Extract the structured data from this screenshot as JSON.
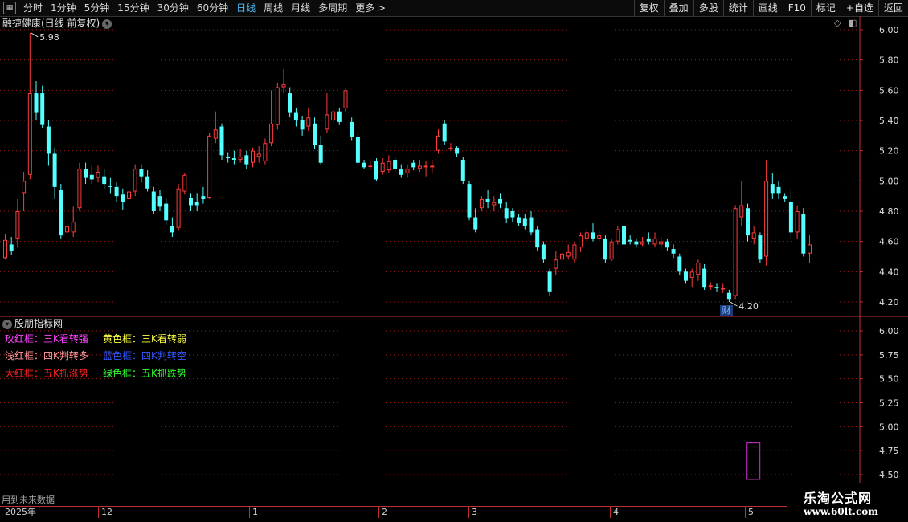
{
  "colors": {
    "up": "#ff3b3b",
    "down": "#54ffff",
    "grid": "#9a1c1c",
    "axis_text": "#e0e0e0",
    "highlight": "#cc33cc"
  },
  "toolbar": {
    "left_items": [
      {
        "label": "分时"
      },
      {
        "label": "1分钟"
      },
      {
        "label": "5分钟"
      },
      {
        "label": "15分钟"
      },
      {
        "label": "30分钟"
      },
      {
        "label": "60分钟"
      },
      {
        "label": "日线",
        "active": true
      },
      {
        "label": "周线"
      },
      {
        "label": "月线"
      },
      {
        "label": "多周期"
      },
      {
        "label": "更多 >"
      }
    ],
    "right_buttons": [
      "复权",
      "叠加",
      "多股",
      "统计",
      "画线",
      "F10",
      "标记",
      "+自选",
      "返回"
    ]
  },
  "main_panel": {
    "title": "融捷健康(日线 前复权)",
    "price_labels": [
      "6.00",
      "5.80",
      "5.60",
      "5.40",
      "5.20",
      "5.00",
      "4.80",
      "4.60",
      "4.40",
      "4.20"
    ],
    "high_annotation": "5.98",
    "low_annotation": "4.20",
    "badge": "财"
  },
  "sub_panel": {
    "title": "股朋指标网",
    "axis_labels": [
      "6.00",
      "5.75",
      "5.50",
      "5.25",
      "5.00",
      "4.75",
      "4.50"
    ],
    "legend": [
      {
        "text": "玫红框：三K看转强",
        "color": "#ff44ff"
      },
      {
        "text": "黄色框：三K看转弱",
        "color": "#ffff44"
      },
      {
        "text": "浅红框：四K判转多",
        "color": "#ff9999"
      },
      {
        "text": "蓝色框：四K判转空",
        "color": "#3355ff"
      },
      {
        "text": "大红框：五K抓涨势",
        "color": "#ff2222"
      },
      {
        "text": "绿色框：五K抓跌势",
        "color": "#33ff33"
      }
    ],
    "footnote": "用到未来数据"
  },
  "date_axis": [
    "2025年",
    "12",
    "1",
    "2",
    "3",
    "4",
    "5"
  ],
  "watermark": {
    "line1": "乐淘公式网",
    "line2": "www.60lt.com"
  },
  "chart_data": {
    "type": "candlestick",
    "title": "融捷健康(日线 前复权)",
    "ylim": [
      4.14,
      6.06
    ],
    "y_ticks": [
      6.0,
      5.8,
      5.6,
      5.4,
      5.2,
      5.0,
      4.8,
      4.6,
      4.4,
      4.2
    ],
    "annotations": [
      {
        "label": "5.98",
        "value": 5.98
      },
      {
        "label": "4.20",
        "value": 4.2
      }
    ],
    "candles": [
      {
        "o": 4.49,
        "c": 4.61,
        "h": 4.65,
        "l": 4.48
      },
      {
        "o": 4.58,
        "c": 4.54,
        "h": 4.63,
        "l": 4.51
      },
      {
        "o": 4.62,
        "c": 4.8,
        "h": 4.88,
        "l": 4.56
      },
      {
        "o": 4.92,
        "c": 5.0,
        "h": 5.06,
        "l": 4.8
      },
      {
        "o": 5.04,
        "c": 5.58,
        "h": 5.98,
        "l": 5.01
      },
      {
        "o": 5.58,
        "c": 5.45,
        "h": 5.66,
        "l": 5.4
      },
      {
        "o": 5.58,
        "c": 5.37,
        "h": 5.63,
        "l": 5.35
      },
      {
        "o": 5.36,
        "c": 5.18,
        "h": 5.4,
        "l": 5.1
      },
      {
        "o": 5.18,
        "c": 4.96,
        "h": 5.22,
        "l": 4.88
      },
      {
        "o": 4.94,
        "c": 4.64,
        "h": 4.98,
        "l": 4.62
      },
      {
        "o": 4.66,
        "c": 4.7,
        "h": 4.74,
        "l": 4.6
      },
      {
        "o": 4.66,
        "c": 4.73,
        "h": 4.83,
        "l": 4.63
      },
      {
        "o": 4.82,
        "c": 5.08,
        "h": 5.12,
        "l": 4.8
      },
      {
        "o": 5.08,
        "c": 5.02,
        "h": 5.12,
        "l": 4.98
      },
      {
        "o": 5.04,
        "c": 5.01,
        "h": 5.1,
        "l": 4.98
      },
      {
        "o": 5.02,
        "c": 5.06,
        "h": 5.1,
        "l": 4.99
      },
      {
        "o": 5.03,
        "c": 4.98,
        "h": 5.08,
        "l": 4.95
      },
      {
        "o": 4.97,
        "c": 4.96,
        "h": 5.02,
        "l": 4.92
      },
      {
        "o": 4.96,
        "c": 4.9,
        "h": 4.99,
        "l": 4.86
      },
      {
        "o": 4.91,
        "c": 4.86,
        "h": 4.95,
        "l": 4.81
      },
      {
        "o": 4.88,
        "c": 4.93,
        "h": 4.96,
        "l": 4.84
      },
      {
        "o": 4.93,
        "c": 5.08,
        "h": 5.11,
        "l": 4.9
      },
      {
        "o": 5.08,
        "c": 5.03,
        "h": 5.11,
        "l": 4.99
      },
      {
        "o": 5.03,
        "c": 4.95,
        "h": 5.07,
        "l": 4.93
      },
      {
        "o": 4.93,
        "c": 4.8,
        "h": 4.96,
        "l": 4.78
      },
      {
        "o": 4.9,
        "c": 4.83,
        "h": 4.94,
        "l": 4.8
      },
      {
        "o": 4.85,
        "c": 4.74,
        "h": 4.89,
        "l": 4.71
      },
      {
        "o": 4.7,
        "c": 4.66,
        "h": 4.76,
        "l": 4.63
      },
      {
        "o": 4.69,
        "c": 4.95,
        "h": 4.98,
        "l": 4.67
      },
      {
        "o": 4.93,
        "c": 5.04,
        "h": 5.05,
        "l": 4.91
      },
      {
        "o": 4.89,
        "c": 4.84,
        "h": 4.92,
        "l": 4.8
      },
      {
        "o": 4.86,
        "c": 4.84,
        "h": 4.92,
        "l": 4.8
      },
      {
        "o": 4.9,
        "c": 4.88,
        "h": 4.96,
        "l": 4.85
      },
      {
        "o": 4.89,
        "c": 5.3,
        "h": 5.32,
        "l": 4.88
      },
      {
        "o": 5.28,
        "c": 5.34,
        "h": 5.46,
        "l": 5.25
      },
      {
        "o": 5.36,
        "c": 5.17,
        "h": 5.38,
        "l": 5.14
      },
      {
        "o": 5.16,
        "c": 5.15,
        "h": 5.19,
        "l": 5.12
      },
      {
        "o": 5.15,
        "c": 5.14,
        "h": 5.2,
        "l": 5.11
      },
      {
        "o": 5.14,
        "c": 5.16,
        "h": 5.21,
        "l": 5.12
      },
      {
        "o": 5.17,
        "c": 5.11,
        "h": 5.2,
        "l": 5.08
      },
      {
        "o": 5.12,
        "c": 5.2,
        "h": 5.22,
        "l": 5.09
      },
      {
        "o": 5.16,
        "c": 5.18,
        "h": 5.23,
        "l": 5.12
      },
      {
        "o": 5.13,
        "c": 5.25,
        "h": 5.28,
        "l": 5.11
      },
      {
        "o": 5.25,
        "c": 5.38,
        "h": 5.6,
        "l": 5.23
      },
      {
        "o": 5.37,
        "c": 5.62,
        "h": 5.65,
        "l": 5.34
      },
      {
        "o": 5.62,
        "c": 5.64,
        "h": 5.74,
        "l": 5.58
      },
      {
        "o": 5.58,
        "c": 5.45,
        "h": 5.62,
        "l": 5.42
      },
      {
        "o": 5.45,
        "c": 5.4,
        "h": 5.48,
        "l": 5.36
      },
      {
        "o": 5.4,
        "c": 5.34,
        "h": 5.43,
        "l": 5.3
      },
      {
        "o": 5.36,
        "c": 5.42,
        "h": 5.48,
        "l": 5.33
      },
      {
        "o": 5.38,
        "c": 5.24,
        "h": 5.42,
        "l": 5.21
      },
      {
        "o": 5.24,
        "c": 5.12,
        "h": 5.3,
        "l": 5.11
      },
      {
        "o": 5.34,
        "c": 5.44,
        "h": 5.58,
        "l": 5.32
      },
      {
        "o": 5.4,
        "c": 5.46,
        "h": 5.55,
        "l": 5.38
      },
      {
        "o": 5.46,
        "c": 5.39,
        "h": 5.48,
        "l": 5.37
      },
      {
        "o": 5.48,
        "c": 5.6,
        "h": 5.61,
        "l": 5.46
      },
      {
        "o": 5.39,
        "c": 5.29,
        "h": 5.42,
        "l": 5.27
      },
      {
        "o": 5.29,
        "c": 5.12,
        "h": 5.32,
        "l": 5.1
      },
      {
        "o": 5.12,
        "c": 5.09,
        "h": 5.14,
        "l": 5.08
      },
      {
        "o": 5.1,
        "c": 5.1,
        "h": 5.13,
        "l": 5.08
      },
      {
        "o": 5.13,
        "c": 5.01,
        "h": 5.15,
        "l": 5.0
      },
      {
        "o": 5.06,
        "c": 5.12,
        "h": 5.15,
        "l": 5.04
      },
      {
        "o": 5.07,
        "c": 5.13,
        "h": 5.17,
        "l": 5.05
      },
      {
        "o": 5.14,
        "c": 5.08,
        "h": 5.16,
        "l": 5.06
      },
      {
        "o": 5.08,
        "c": 5.04,
        "h": 5.11,
        "l": 5.02
      },
      {
        "o": 5.05,
        "c": 5.08,
        "h": 5.11,
        "l": 5.02
      },
      {
        "o": 5.12,
        "c": 5.09,
        "h": 5.14,
        "l": 5.07
      },
      {
        "o": 5.08,
        "c": 5.1,
        "h": 5.14,
        "l": 5.06
      },
      {
        "o": 5.09,
        "c": 5.1,
        "h": 5.13,
        "l": 5.03
      },
      {
        "o": 5.09,
        "c": 5.1,
        "h": 5.14,
        "l": 5.05
      },
      {
        "o": 5.2,
        "c": 5.3,
        "h": 5.34,
        "l": 5.18
      },
      {
        "o": 5.38,
        "c": 5.26,
        "h": 5.4,
        "l": 5.24
      },
      {
        "o": 5.22,
        "c": 5.22,
        "h": 5.25,
        "l": 5.2
      },
      {
        "o": 5.22,
        "c": 5.18,
        "h": 5.23,
        "l": 5.16
      },
      {
        "o": 5.14,
        "c": 5.0,
        "h": 5.16,
        "l": 4.98
      },
      {
        "o": 4.98,
        "c": 4.76,
        "h": 5.0,
        "l": 4.74
      },
      {
        "o": 4.76,
        "c": 4.68,
        "h": 4.82,
        "l": 4.66
      },
      {
        "o": 4.82,
        "c": 4.88,
        "h": 4.9,
        "l": 4.8
      },
      {
        "o": 4.88,
        "c": 4.86,
        "h": 4.94,
        "l": 4.82
      },
      {
        "o": 4.84,
        "c": 4.86,
        "h": 4.9,
        "l": 4.8
      },
      {
        "o": 4.88,
        "c": 4.85,
        "h": 4.92,
        "l": 4.82
      },
      {
        "o": 4.82,
        "c": 4.75,
        "h": 4.86,
        "l": 4.72
      },
      {
        "o": 4.8,
        "c": 4.76,
        "h": 4.82,
        "l": 4.73
      },
      {
        "o": 4.76,
        "c": 4.72,
        "h": 4.78,
        "l": 4.7
      },
      {
        "o": 4.75,
        "c": 4.7,
        "h": 4.78,
        "l": 4.68
      },
      {
        "o": 4.76,
        "c": 4.66,
        "h": 4.8,
        "l": 4.64
      },
      {
        "o": 4.68,
        "c": 4.56,
        "h": 4.7,
        "l": 4.54
      },
      {
        "o": 4.58,
        "c": 4.48,
        "h": 4.6,
        "l": 4.46
      },
      {
        "o": 4.4,
        "c": 4.27,
        "h": 4.42,
        "l": 4.24
      },
      {
        "o": 4.42,
        "c": 4.48,
        "h": 4.54,
        "l": 4.38
      },
      {
        "o": 4.48,
        "c": 4.52,
        "h": 4.56,
        "l": 4.46
      },
      {
        "o": 4.5,
        "c": 4.53,
        "h": 4.58,
        "l": 4.48
      },
      {
        "o": 4.48,
        "c": 4.58,
        "h": 4.6,
        "l": 4.46
      },
      {
        "o": 4.56,
        "c": 4.64,
        "h": 4.66,
        "l": 4.53
      },
      {
        "o": 4.62,
        "c": 4.66,
        "h": 4.68,
        "l": 4.6
      },
      {
        "o": 4.66,
        "c": 4.62,
        "h": 4.72,
        "l": 4.6
      },
      {
        "o": 4.62,
        "c": 4.64,
        "h": 4.67,
        "l": 4.6
      },
      {
        "o": 4.62,
        "c": 4.48,
        "h": 4.64,
        "l": 4.46
      },
      {
        "o": 4.48,
        "c": 4.6,
        "h": 4.62,
        "l": 4.47
      },
      {
        "o": 4.6,
        "c": 4.68,
        "h": 4.7,
        "l": 4.58
      },
      {
        "o": 4.7,
        "c": 4.58,
        "h": 4.72,
        "l": 4.56
      },
      {
        "o": 4.61,
        "c": 4.6,
        "h": 4.64,
        "l": 4.58
      },
      {
        "o": 4.6,
        "c": 4.58,
        "h": 4.62,
        "l": 4.56
      },
      {
        "o": 4.58,
        "c": 4.6,
        "h": 4.63,
        "l": 4.57
      },
      {
        "o": 4.62,
        "c": 4.6,
        "h": 4.66,
        "l": 4.58
      },
      {
        "o": 4.58,
        "c": 4.62,
        "h": 4.66,
        "l": 4.56
      },
      {
        "o": 4.58,
        "c": 4.6,
        "h": 4.63,
        "l": 4.55
      },
      {
        "o": 4.6,
        "c": 4.56,
        "h": 4.62,
        "l": 4.54
      },
      {
        "o": 4.55,
        "c": 4.52,
        "h": 4.58,
        "l": 4.49
      },
      {
        "o": 4.5,
        "c": 4.4,
        "h": 4.52,
        "l": 4.38
      },
      {
        "o": 4.4,
        "c": 4.34,
        "h": 4.42,
        "l": 4.32
      },
      {
        "o": 4.36,
        "c": 4.4,
        "h": 4.42,
        "l": 4.3
      },
      {
        "o": 4.38,
        "c": 4.46,
        "h": 4.48,
        "l": 4.34
      },
      {
        "o": 4.42,
        "c": 4.3,
        "h": 4.45,
        "l": 4.28
      },
      {
        "o": 4.3,
        "c": 4.31,
        "h": 4.33,
        "l": 4.28
      },
      {
        "o": 4.3,
        "c": 4.29,
        "h": 4.32,
        "l": 4.27
      },
      {
        "o": 4.29,
        "c": 4.29,
        "h": 4.32,
        "l": 4.26
      },
      {
        "o": 4.26,
        "c": 4.22,
        "h": 4.28,
        "l": 4.2
      },
      {
        "o": 4.24,
        "c": 4.82,
        "h": 4.84,
        "l": 4.22
      },
      {
        "o": 4.76,
        "c": 4.84,
        "h": 5.0,
        "l": 4.7
      },
      {
        "o": 4.82,
        "c": 4.64,
        "h": 4.85,
        "l": 4.6
      },
      {
        "o": 4.62,
        "c": 4.66,
        "h": 4.7,
        "l": 4.58
      },
      {
        "o": 4.64,
        "c": 4.48,
        "h": 4.66,
        "l": 4.46
      },
      {
        "o": 4.5,
        "c": 5.0,
        "h": 5.14,
        "l": 4.44
      },
      {
        "o": 4.98,
        "c": 4.92,
        "h": 5.05,
        "l": 4.88
      },
      {
        "o": 4.96,
        "c": 4.92,
        "h": 5.0,
        "l": 4.88
      },
      {
        "o": 4.9,
        "c": 4.88,
        "h": 4.92,
        "l": 4.86
      },
      {
        "o": 4.86,
        "c": 4.66,
        "h": 4.95,
        "l": 4.62
      },
      {
        "o": 4.66,
        "c": 4.8,
        "h": 4.84,
        "l": 4.62
      },
      {
        "o": 4.78,
        "c": 4.52,
        "h": 4.82,
        "l": 4.5
      },
      {
        "o": 4.52,
        "c": 4.58,
        "h": 4.64,
        "l": 4.46
      }
    ],
    "overlay_box": {
      "label": "玫红框",
      "candle_index": 121,
      "from": 4.45,
      "to": 4.83
    }
  }
}
